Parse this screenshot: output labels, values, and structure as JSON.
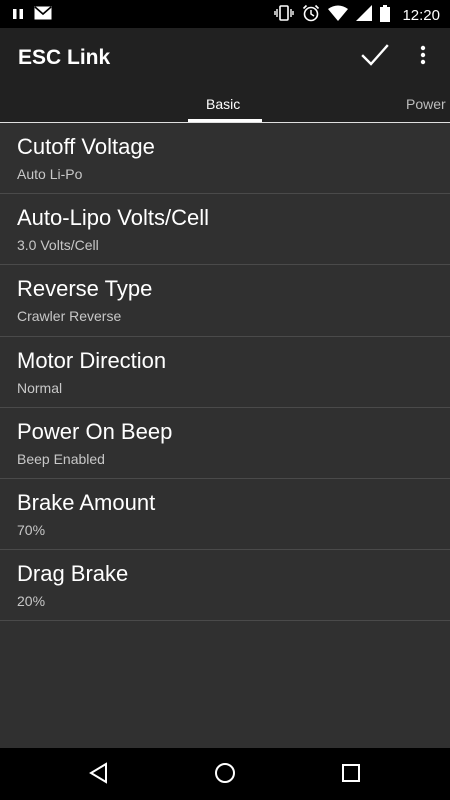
{
  "status_bar": {
    "time": "12:20",
    "icons": [
      "pause-icon",
      "mail-icon",
      "vibrate-icon",
      "alarm-icon",
      "wifi-icon",
      "cellular-icon",
      "battery-icon"
    ]
  },
  "app_bar": {
    "title": "ESC Link",
    "actions": [
      "check-icon",
      "more-vert-icon"
    ]
  },
  "tabs": [
    {
      "label": "Basic",
      "selected": true
    },
    {
      "label": "Power",
      "selected": false
    }
  ],
  "preferences": [
    {
      "title": "Cutoff Voltage",
      "summary": "Auto Li-Po"
    },
    {
      "title": "Auto-Lipo Volts/Cell",
      "summary": "3.0 Volts/Cell"
    },
    {
      "title": "Reverse Type",
      "summary": "Crawler Reverse"
    },
    {
      "title": "Motor Direction",
      "summary": "Normal"
    },
    {
      "title": "Power On Beep",
      "summary": "Beep Enabled"
    },
    {
      "title": "Brake Amount",
      "summary": "70%"
    },
    {
      "title": "Drag Brake",
      "summary": "20%"
    }
  ],
  "nav_bar": {
    "buttons": [
      "back-icon",
      "home-icon",
      "recents-icon"
    ]
  },
  "colors": {
    "background": "#303030",
    "app_bar": "#212121",
    "status_bar": "#000000",
    "divider": "#4a4a4a",
    "summary_text": "#c8c8c8"
  }
}
